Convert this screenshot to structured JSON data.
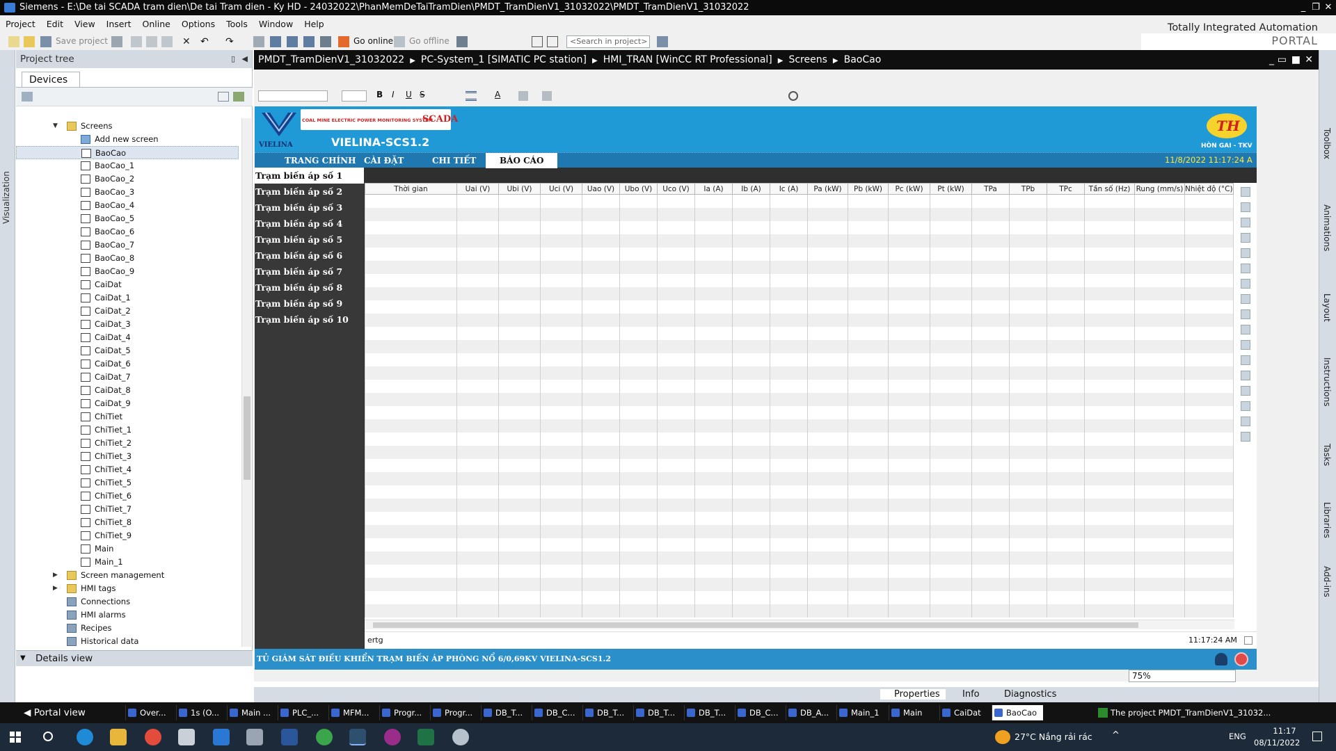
{
  "window": {
    "title": "Siemens  -  E:\\De tai SCADA tram dien\\De tai Tram dien - Ky HD - 24032022\\PhanMemDeTaiTramDien\\PMDT_TramDienV1_31032022\\PMDT_TramDienV1_31032022"
  },
  "menu": [
    "Project",
    "Edit",
    "View",
    "Insert",
    "Online",
    "Options",
    "Tools",
    "Window",
    "Help"
  ],
  "brand": {
    "line1": "Totally Integrated Automation",
    "line2": "PORTAL"
  },
  "toolbar": {
    "save_label": "Save project",
    "go_online": "Go online",
    "go_offline": "Go offline",
    "search_placeholder": "<Search in project>"
  },
  "left_tab": "Visualization",
  "project_tree": {
    "title": "Project tree",
    "devices_tab": "Devices",
    "items": [
      {
        "label": "Screens",
        "level": 0,
        "icon": "folder"
      },
      {
        "label": "Add new screen",
        "level": 1,
        "icon": "add"
      },
      {
        "label": "BaoCao",
        "level": 1,
        "icon": "screen",
        "selected": true
      },
      {
        "label": "BaoCao_1",
        "level": 1,
        "icon": "screen"
      },
      {
        "label": "BaoCao_2",
        "level": 1,
        "icon": "screen"
      },
      {
        "label": "BaoCao_3",
        "level": 1,
        "icon": "screen"
      },
      {
        "label": "BaoCao_4",
        "level": 1,
        "icon": "screen"
      },
      {
        "label": "BaoCao_5",
        "level": 1,
        "icon": "screen"
      },
      {
        "label": "BaoCao_6",
        "level": 1,
        "icon": "screen"
      },
      {
        "label": "BaoCao_7",
        "level": 1,
        "icon": "screen"
      },
      {
        "label": "BaoCao_8",
        "level": 1,
        "icon": "screen"
      },
      {
        "label": "BaoCao_9",
        "level": 1,
        "icon": "screen"
      },
      {
        "label": "CaiDat",
        "level": 1,
        "icon": "screen"
      },
      {
        "label": "CaiDat_1",
        "level": 1,
        "icon": "screen"
      },
      {
        "label": "CaiDat_2",
        "level": 1,
        "icon": "screen"
      },
      {
        "label": "CaiDat_3",
        "level": 1,
        "icon": "screen"
      },
      {
        "label": "CaiDat_4",
        "level": 1,
        "icon": "screen"
      },
      {
        "label": "CaiDat_5",
        "level": 1,
        "icon": "screen"
      },
      {
        "label": "CaiDat_6",
        "level": 1,
        "icon": "screen"
      },
      {
        "label": "CaiDat_7",
        "level": 1,
        "icon": "screen"
      },
      {
        "label": "CaiDat_8",
        "level": 1,
        "icon": "screen"
      },
      {
        "label": "CaiDat_9",
        "level": 1,
        "icon": "screen"
      },
      {
        "label": "ChiTiet",
        "level": 1,
        "icon": "screen"
      },
      {
        "label": "ChiTiet_1",
        "level": 1,
        "icon": "screen"
      },
      {
        "label": "ChiTiet_2",
        "level": 1,
        "icon": "screen"
      },
      {
        "label": "ChiTiet_3",
        "level": 1,
        "icon": "screen"
      },
      {
        "label": "ChiTiet_4",
        "level": 1,
        "icon": "screen"
      },
      {
        "label": "ChiTiet_5",
        "level": 1,
        "icon": "screen"
      },
      {
        "label": "ChiTiet_6",
        "level": 1,
        "icon": "screen"
      },
      {
        "label": "ChiTiet_7",
        "level": 1,
        "icon": "screen"
      },
      {
        "label": "ChiTiet_8",
        "level": 1,
        "icon": "screen"
      },
      {
        "label": "ChiTiet_9",
        "level": 1,
        "icon": "screen"
      },
      {
        "label": "Main",
        "level": 1,
        "icon": "screen"
      },
      {
        "label": "Main_1",
        "level": 1,
        "icon": "screen"
      },
      {
        "label": "Screen management",
        "level": 0,
        "icon": "folder",
        "collapsed": true
      },
      {
        "label": "HMI tags",
        "level": 0,
        "icon": "folder",
        "collapsed": true
      },
      {
        "label": "Connections",
        "level": 0,
        "icon": "connections"
      },
      {
        "label": "HMI alarms",
        "level": 0,
        "icon": "alarms"
      },
      {
        "label": "Recipes",
        "level": 0,
        "icon": "recipes"
      },
      {
        "label": "Historical data",
        "level": 0,
        "icon": "historical"
      }
    ]
  },
  "details_view": "Details view",
  "breadcrumb": [
    "PMDT_TramDienV1_31032022",
    "PC-System_1 [SIMATIC PC station]",
    "HMI_TRAN [WinCC RT Professional]",
    "Screens",
    "BaoCao"
  ],
  "hmi": {
    "logo_text": "VIELINA",
    "banner_small": "COAL MINE ELECTRIC POWER MONITORING SYSTEM",
    "banner_scada": "SCADA",
    "system_name": "VIELINA-SCS1.2",
    "right_logo_text": "HÒN GAI - TKV",
    "datetime": "11/8/2022 11:17:24 A",
    "tabs": [
      "TRANG CHÍNH",
      "CÀI ĐẶT",
      "CHI TIẾT",
      "BÁO CÁO"
    ],
    "active_tab": "BÁO CÁO",
    "stations": [
      "Trạm biến áp số 1",
      "Trạm biến áp số 2",
      "Trạm biến áp số 3",
      "Trạm biến áp số 4",
      "Trạm biến áp số 5",
      "Trạm biến áp số 6",
      "Trạm biến áp số 7",
      "Trạm biến áp số 8",
      "Trạm biến áp số 9",
      "Trạm biến áp số 10"
    ],
    "table_columns": [
      "Thời gian",
      "Uai (V)",
      "Ubi (V)",
      "Uci (V)",
      "Uao (V)",
      "Ubo (V)",
      "Uco (V)",
      "Ia (A)",
      "Ib (A)",
      "Ic (A)",
      "Pa (kW)",
      "Pb (kW)",
      "Pc (kW)",
      "Pt (kW)",
      "TPa",
      "TPb",
      "TPc",
      "Tần số (Hz)",
      "Rung (mm/s)",
      "Nhiệt độ (°C)"
    ],
    "table_footer_left": "ertg",
    "table_footer_time": "11:17:24 AM",
    "footer": "TỦ GIÁM SÁT ĐIỀU KHIỂN TRẠM BIẾN ÁP PHÒNG NỔ 6/0,69KV VIELINA-SCS1.2"
  },
  "right_tabs": [
    "Toolbox",
    "Animations",
    "Layout",
    "Instructions",
    "Tasks",
    "Libraries",
    "Add-ins"
  ],
  "zoom": "75%",
  "properties_bar": {
    "properties": "Properties",
    "info": "Info",
    "diagnostics": "Diagnostics"
  },
  "portal": {
    "portal_view": "Portal view",
    "tasks": [
      "Over...",
      "1s (O...",
      "Main ...",
      "PLC_...",
      "MFM...",
      "Progr...",
      "Progr...",
      "DB_T...",
      "DB_C...",
      "DB_T...",
      "DB_T...",
      "DB_T...",
      "DB_C...",
      "DB_A...",
      "Main_1",
      "Main",
      "CaiDat",
      "BaoCao"
    ],
    "active_task": "BaoCao",
    "status_msg": "The project PMDT_TramDienV1_31032..."
  },
  "taskbar": {
    "weather": "27°C  Nắng rải rác",
    "lang": "ENG",
    "time": "11:17",
    "date": "08/11/2022"
  },
  "colors": {
    "hmi_header": "#1f9ad6",
    "hmi_tabs": "#1f78b0",
    "hmi_footer": "#2b8fc9",
    "station_bg": "#383838",
    "datetime": "#ffe840"
  }
}
